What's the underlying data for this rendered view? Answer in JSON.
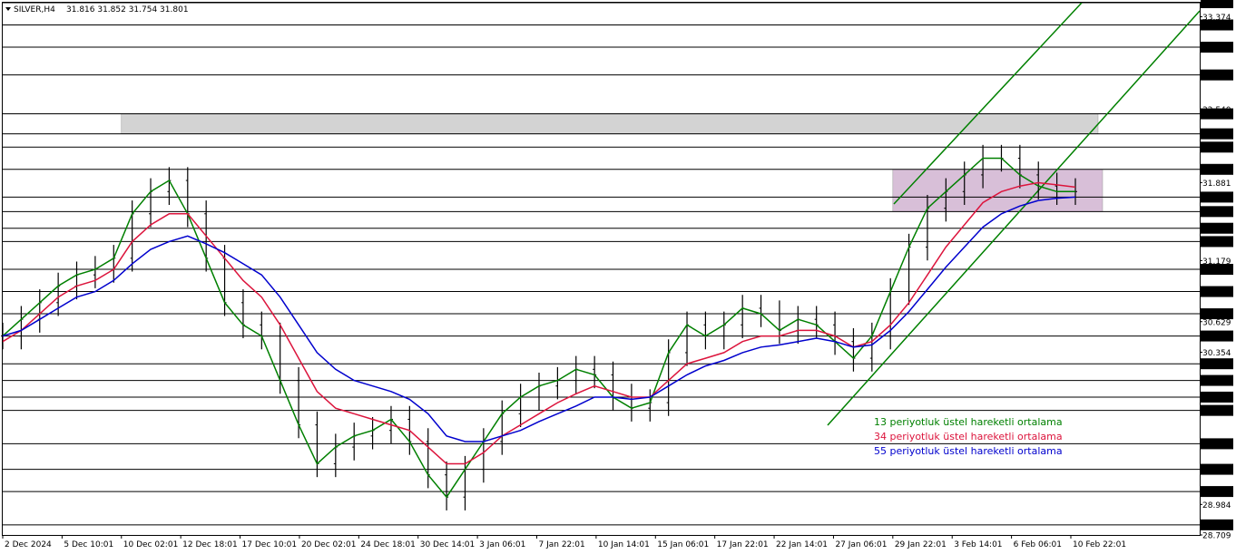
{
  "header": {
    "symbol_timeframe": "SILVER,H4",
    "ohlc": "31.816 31.852 31.754 31.801"
  },
  "chart_data": {
    "type": "line",
    "title": "",
    "xlabel": "",
    "ylabel": "",
    "ylim": [
      28.709,
      33.5
    ],
    "price_axis_labels": [
      "33.500",
      "33.374",
      "33.300",
      "33.100",
      "32.850",
      "32.540",
      "32.500",
      "32.320",
      "32.200",
      "32.000",
      "31.881",
      "31.750",
      "31.620",
      "31.470",
      "31.350",
      "31.179",
      "31.100",
      "30.900",
      "30.700",
      "30.629",
      "30.500",
      "30.354",
      "30.250",
      "30.100",
      "29.950",
      "29.830",
      "29.530",
      "29.300",
      "29.100",
      "28.984",
      "28.800",
      "28.709"
    ],
    "horizontal_levels": [
      33.5,
      33.3,
      33.1,
      32.85,
      32.5,
      32.32,
      32.2,
      32.0,
      31.75,
      31.62,
      31.47,
      31.35,
      31.1,
      30.9,
      30.7,
      30.5,
      30.25,
      30.1,
      29.95,
      29.83,
      29.53,
      29.3,
      29.1,
      28.8
    ],
    "time_labels": [
      "2 Dec 2024",
      "5 Dec 10:01",
      "10 Dec 02:01",
      "12 Dec 18:01",
      "17 Dec 10:01",
      "20 Dec 02:01",
      "24 Dec 18:01",
      "30 Dec 14:01",
      "3 Jan 06:01",
      "7 Jan 22:01",
      "10 Jan 14:01",
      "15 Jan 06:01",
      "17 Jan 22:01",
      "22 Jan 14:01",
      "27 Jan 06:01",
      "29 Jan 22:01",
      "3 Feb 14:01",
      "6 Feb 06:01",
      "10 Feb 22:01"
    ],
    "series": [
      {
        "name": "13 periyotluk üstel hareketli ortalama",
        "color": "#008000",
        "values": [
          30.5,
          30.65,
          30.8,
          30.95,
          31.05,
          31.1,
          31.2,
          31.6,
          31.8,
          31.9,
          31.6,
          31.2,
          30.8,
          30.6,
          30.5,
          30.1,
          29.7,
          29.35,
          29.5,
          29.6,
          29.65,
          29.75,
          29.55,
          29.25,
          29.05,
          29.3,
          29.55,
          29.8,
          29.95,
          30.05,
          30.1,
          30.2,
          30.15,
          29.95,
          29.85,
          29.9,
          30.35,
          30.6,
          30.5,
          30.6,
          30.75,
          30.7,
          30.55,
          30.65,
          30.6,
          30.45,
          30.3,
          30.5,
          30.9,
          31.3,
          31.65,
          31.8,
          31.95,
          32.1,
          32.1,
          31.95,
          31.85,
          31.8,
          31.8
        ]
      },
      {
        "name": "34 periyotluk üstel hareketli ortalama",
        "color": "#dc143c",
        "values": [
          30.45,
          30.55,
          30.7,
          30.85,
          30.95,
          31.0,
          31.1,
          31.35,
          31.5,
          31.6,
          31.6,
          31.4,
          31.2,
          31.0,
          30.85,
          30.6,
          30.3,
          30.0,
          29.85,
          29.8,
          29.75,
          29.7,
          29.65,
          29.5,
          29.35,
          29.35,
          29.45,
          29.6,
          29.7,
          29.8,
          29.9,
          29.98,
          30.05,
          30.0,
          29.95,
          29.95,
          30.1,
          30.25,
          30.3,
          30.35,
          30.45,
          30.5,
          30.5,
          30.55,
          30.55,
          30.5,
          30.4,
          30.45,
          30.6,
          30.8,
          31.05,
          31.3,
          31.5,
          31.7,
          31.8,
          31.85,
          31.88,
          31.86,
          31.84
        ]
      },
      {
        "name": "55 periyotluk üstel hareketli ortalama",
        "color": "#0000cd",
        "values": [
          30.5,
          30.55,
          30.65,
          30.75,
          30.85,
          30.9,
          31.0,
          31.15,
          31.28,
          31.35,
          31.4,
          31.33,
          31.25,
          31.15,
          31.05,
          30.85,
          30.6,
          30.35,
          30.2,
          30.1,
          30.05,
          30.0,
          29.93,
          29.8,
          29.6,
          29.55,
          29.55,
          29.6,
          29.65,
          29.73,
          29.8,
          29.87,
          29.95,
          29.95,
          29.93,
          29.95,
          30.05,
          30.15,
          30.23,
          30.28,
          30.35,
          30.4,
          30.42,
          30.45,
          30.48,
          30.45,
          30.4,
          30.42,
          30.55,
          30.72,
          30.92,
          31.12,
          31.3,
          31.48,
          31.6,
          31.67,
          31.72,
          31.74,
          31.75
        ]
      }
    ],
    "annotations": [
      "13 periyotluk üstel hareketli ortalama",
      "34 periyotluk üstel hareketli ortalama",
      "55 periyotluk üstel hareketli ortalama"
    ],
    "zones": [
      {
        "name": "resistance-zone",
        "from_label": "10 Dec 02:01",
        "to_label": "10 Feb 22:01",
        "low": 32.32,
        "high": 32.5,
        "color": "#d3d3d3"
      },
      {
        "name": "consolidation-zone",
        "from_label": "29 Jan 22:01",
        "to_label": "10 Feb 22:01",
        "low": 31.62,
        "high": 32.0,
        "color": "#d8bfd8"
      }
    ],
    "channel_color": "#008000",
    "grid": false
  }
}
